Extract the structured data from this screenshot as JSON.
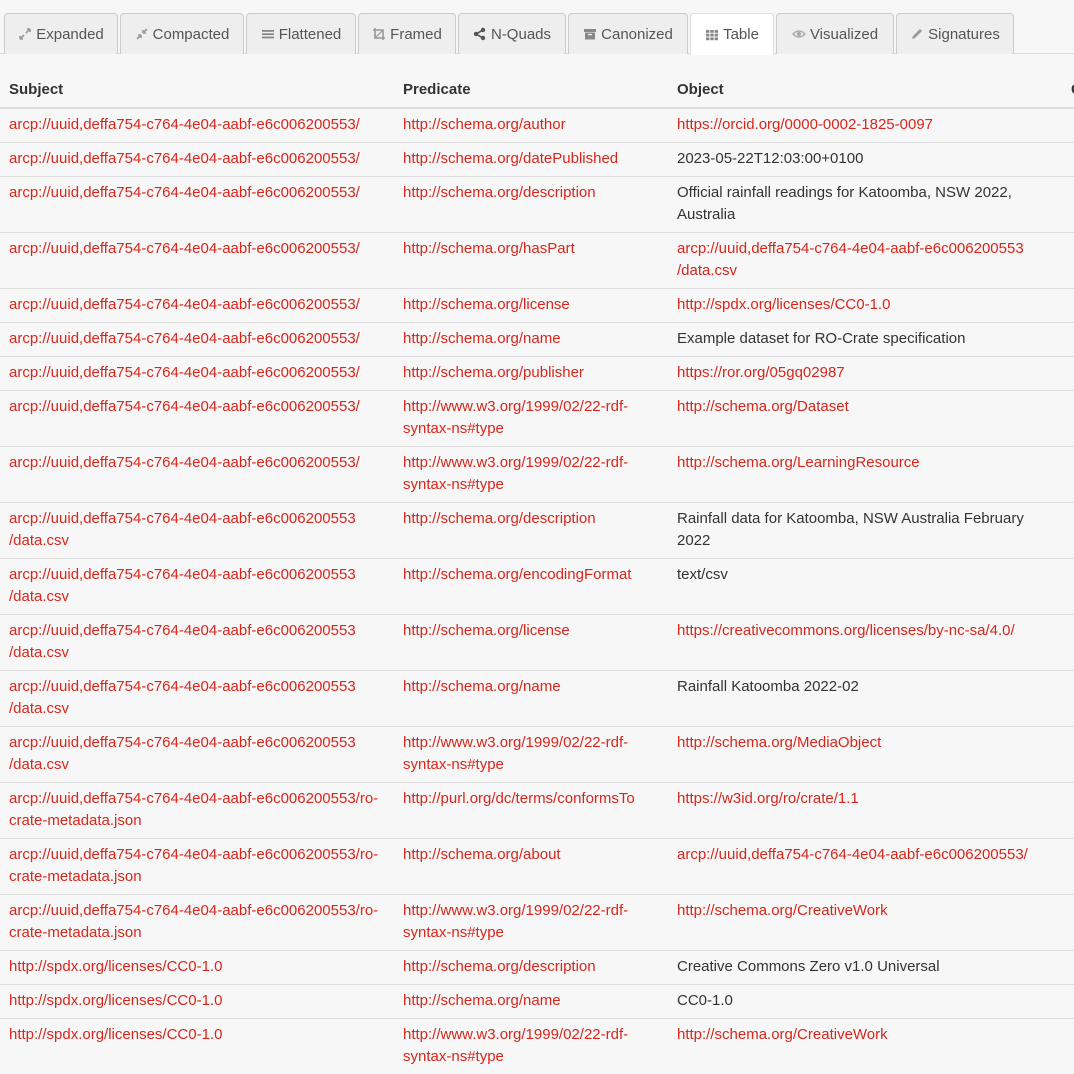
{
  "tabs": [
    {
      "label": "Expanded",
      "icon": "expand-icon",
      "active": false
    },
    {
      "label": "Compacted",
      "icon": "compress-icon",
      "active": false
    },
    {
      "label": "Flattened",
      "icon": "list-icon",
      "active": false
    },
    {
      "label": "Framed",
      "icon": "crop-icon",
      "active": false
    },
    {
      "label": "N-Quads",
      "icon": "share-nodes-icon",
      "active": false
    },
    {
      "label": "Canonized",
      "icon": "archive-icon",
      "active": false
    },
    {
      "label": "Table",
      "icon": "grid-icon",
      "active": true
    },
    {
      "label": "Visualized",
      "icon": "eye-icon",
      "active": false
    },
    {
      "label": "Signatures",
      "icon": "pencil-icon",
      "active": false
    }
  ],
  "table": {
    "columns": [
      "Subject",
      "Predicate",
      "Object",
      "Graph"
    ],
    "rows": [
      {
        "subject": "arcp://uuid,deffa754-c764-4e04-aabf-e6c006200553/",
        "predicate": "http://schema.org/author",
        "object": "https://orcid.org/0000-0002-1825-0097",
        "object_is_link": true
      },
      {
        "subject": "arcp://uuid,deffa754-c764-4e04-aabf-e6c006200553/",
        "predicate": "http://schema.org/datePublished",
        "object": "2023-05-22T12:03:00+0100",
        "object_is_link": false
      },
      {
        "subject": "arcp://uuid,deffa754-c764-4e04-aabf-e6c006200553/",
        "predicate": "http://schema.org/description",
        "object": "Official rainfall readings for Katoomba, NSW 2022, Australia",
        "object_is_link": false
      },
      {
        "subject": "arcp://uuid,deffa754-c764-4e04-aabf-e6c006200553/",
        "predicate": "http://schema.org/hasPart",
        "object": "arcp://uuid,deffa754-c764-4e04-aabf-e6c006200553 /data.csv",
        "object_is_link": true
      },
      {
        "subject": "arcp://uuid,deffa754-c764-4e04-aabf-e6c006200553/",
        "predicate": "http://schema.org/license",
        "object": "http://spdx.org/licenses/CC0-1.0",
        "object_is_link": true
      },
      {
        "subject": "arcp://uuid,deffa754-c764-4e04-aabf-e6c006200553/",
        "predicate": "http://schema.org/name",
        "object": "Example dataset for RO-Crate specification",
        "object_is_link": false
      },
      {
        "subject": "arcp://uuid,deffa754-c764-4e04-aabf-e6c006200553/",
        "predicate": "http://schema.org/publisher",
        "object": "https://ror.org/05gq02987",
        "object_is_link": true
      },
      {
        "subject": "arcp://uuid,deffa754-c764-4e04-aabf-e6c006200553/",
        "predicate": "http://www.w3.org/1999/02/22-rdf-syntax-ns#type",
        "object": "http://schema.org/Dataset",
        "object_is_link": true
      },
      {
        "subject": "arcp://uuid,deffa754-c764-4e04-aabf-e6c006200553/",
        "predicate": "http://www.w3.org/1999/02/22-rdf-syntax-ns#type",
        "object": "http://schema.org/LearningResource",
        "object_is_link": true
      },
      {
        "subject": "arcp://uuid,deffa754-c764-4e04-aabf-e6c006200553 /data.csv",
        "predicate": "http://schema.org/description",
        "object": "Rainfall data for Katoomba, NSW Australia February 2022",
        "object_is_link": false
      },
      {
        "subject": "arcp://uuid,deffa754-c764-4e04-aabf-e6c006200553 /data.csv",
        "predicate": "http://schema.org/encodingFormat",
        "object": "text/csv",
        "object_is_link": false
      },
      {
        "subject": "arcp://uuid,deffa754-c764-4e04-aabf-e6c006200553 /data.csv",
        "predicate": "http://schema.org/license",
        "object": "https://creativecommons.org/licenses/by-nc-sa/4.0/",
        "object_is_link": true
      },
      {
        "subject": "arcp://uuid,deffa754-c764-4e04-aabf-e6c006200553 /data.csv",
        "predicate": "http://schema.org/name",
        "object": "Rainfall Katoomba 2022-02",
        "object_is_link": false
      },
      {
        "subject": "arcp://uuid,deffa754-c764-4e04-aabf-e6c006200553 /data.csv",
        "predicate": "http://www.w3.org/1999/02/22-rdf-syntax-ns#type",
        "object": "http://schema.org/MediaObject",
        "object_is_link": true
      },
      {
        "subject": "arcp://uuid,deffa754-c764-4e04-aabf-e6c006200553/ro-crate-metadata.json",
        "predicate": "http://purl.org/dc/terms/conformsTo",
        "object": "https://w3id.org/ro/crate/1.1",
        "object_is_link": true
      },
      {
        "subject": "arcp://uuid,deffa754-c764-4e04-aabf-e6c006200553/ro-crate-metadata.json",
        "predicate": "http://schema.org/about",
        "object": "arcp://uuid,deffa754-c764-4e04-aabf-e6c006200553/",
        "object_is_link": true
      },
      {
        "subject": "arcp://uuid,deffa754-c764-4e04-aabf-e6c006200553/ro-crate-metadata.json",
        "predicate": "http://www.w3.org/1999/02/22-rdf-syntax-ns#type",
        "object": "http://schema.org/CreativeWork",
        "object_is_link": true
      },
      {
        "subject": "http://spdx.org/licenses/CC0-1.0",
        "predicate": "http://schema.org/description",
        "object": "Creative Commons Zero v1.0 Universal",
        "object_is_link": false
      },
      {
        "subject": "http://spdx.org/licenses/CC0-1.0",
        "predicate": "http://schema.org/name",
        "object": "CC0-1.0",
        "object_is_link": false
      },
      {
        "subject": "http://spdx.org/licenses/CC0-1.0",
        "predicate": "http://www.w3.org/1999/02/22-rdf-syntax-ns#type",
        "object": "http://schema.org/CreativeWork",
        "object_is_link": true
      }
    ]
  },
  "colors": {
    "link": "#d9261c",
    "text": "#333333",
    "background": "#f7f7f7",
    "tab_bg": "#eeeeee",
    "tab_active_bg": "#ffffff",
    "border": "#dddddd"
  }
}
